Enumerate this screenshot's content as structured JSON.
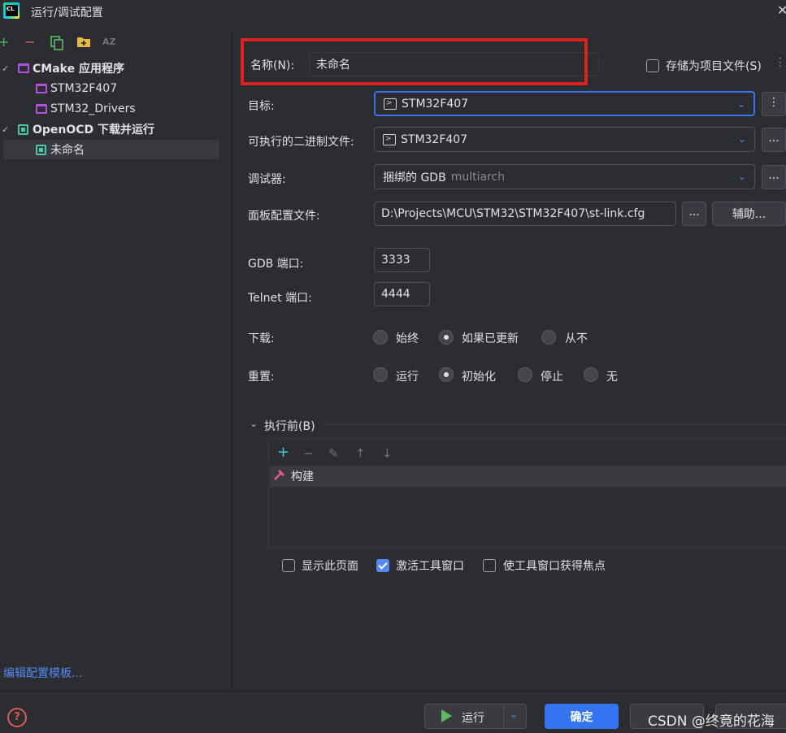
{
  "window": {
    "title": "运行/调试配置"
  },
  "toolbar": {
    "add": "+",
    "remove": "−",
    "sort": "AZ"
  },
  "tree": [
    {
      "label": "CMake 应用程序",
      "kind": "group"
    },
    {
      "label": "STM32F407",
      "kind": "cmake"
    },
    {
      "label": "STM32_Drivers",
      "kind": "cmake"
    },
    {
      "label": "OpenOCD 下载并运行",
      "kind": "group"
    },
    {
      "label": "未命名",
      "kind": "openocd",
      "selected": true
    }
  ],
  "edit_templates": "编辑配置模板...",
  "form": {
    "name_label": "名称(N):",
    "name_value": "未命名",
    "store_project_label": "存储为项目文件(S)",
    "target_label": "目标:",
    "target_value": "STM32F407",
    "executable_label": "可执行的二进制文件:",
    "executable_value": "STM32F407",
    "debugger_label": "调试器:",
    "debugger_value": "捆绑的 GDB",
    "debugger_suffix": "multiarch",
    "board_label": "面板配置文件:",
    "board_value": "D:\\Projects\\MCU\\STM32\\STM32F407\\st-link.cfg",
    "browse": "...",
    "assist": "辅助...",
    "gdb_port_label": "GDB 端口:",
    "gdb_port_value": "3333",
    "telnet_port_label": "Telnet 端口:",
    "telnet_port_value": "4444",
    "download_label": "下载:",
    "download_options": [
      "始终",
      "如果已更新",
      "从不"
    ],
    "download_selected": 1,
    "reset_label": "重置:",
    "reset_options": [
      "运行",
      "初始化",
      "停止",
      "无"
    ],
    "reset_selected": 1,
    "before_launch_label": "执行前(B)",
    "before_tasks": [
      "构建"
    ],
    "show_page_label": "显示此页面",
    "show_page_checked": false,
    "activate_tool_label": "激活工具窗口",
    "activate_tool_checked": true,
    "focus_tool_label": "使工具窗口获得焦点",
    "focus_tool_checked": false
  },
  "footer": {
    "help": "?",
    "run": "运行",
    "ok": "确定",
    "watermark": "CSDN @终竟的花海"
  },
  "colors": {
    "accent": "#3574f0",
    "highlight_box": "#e0201f",
    "link": "#548af7"
  }
}
